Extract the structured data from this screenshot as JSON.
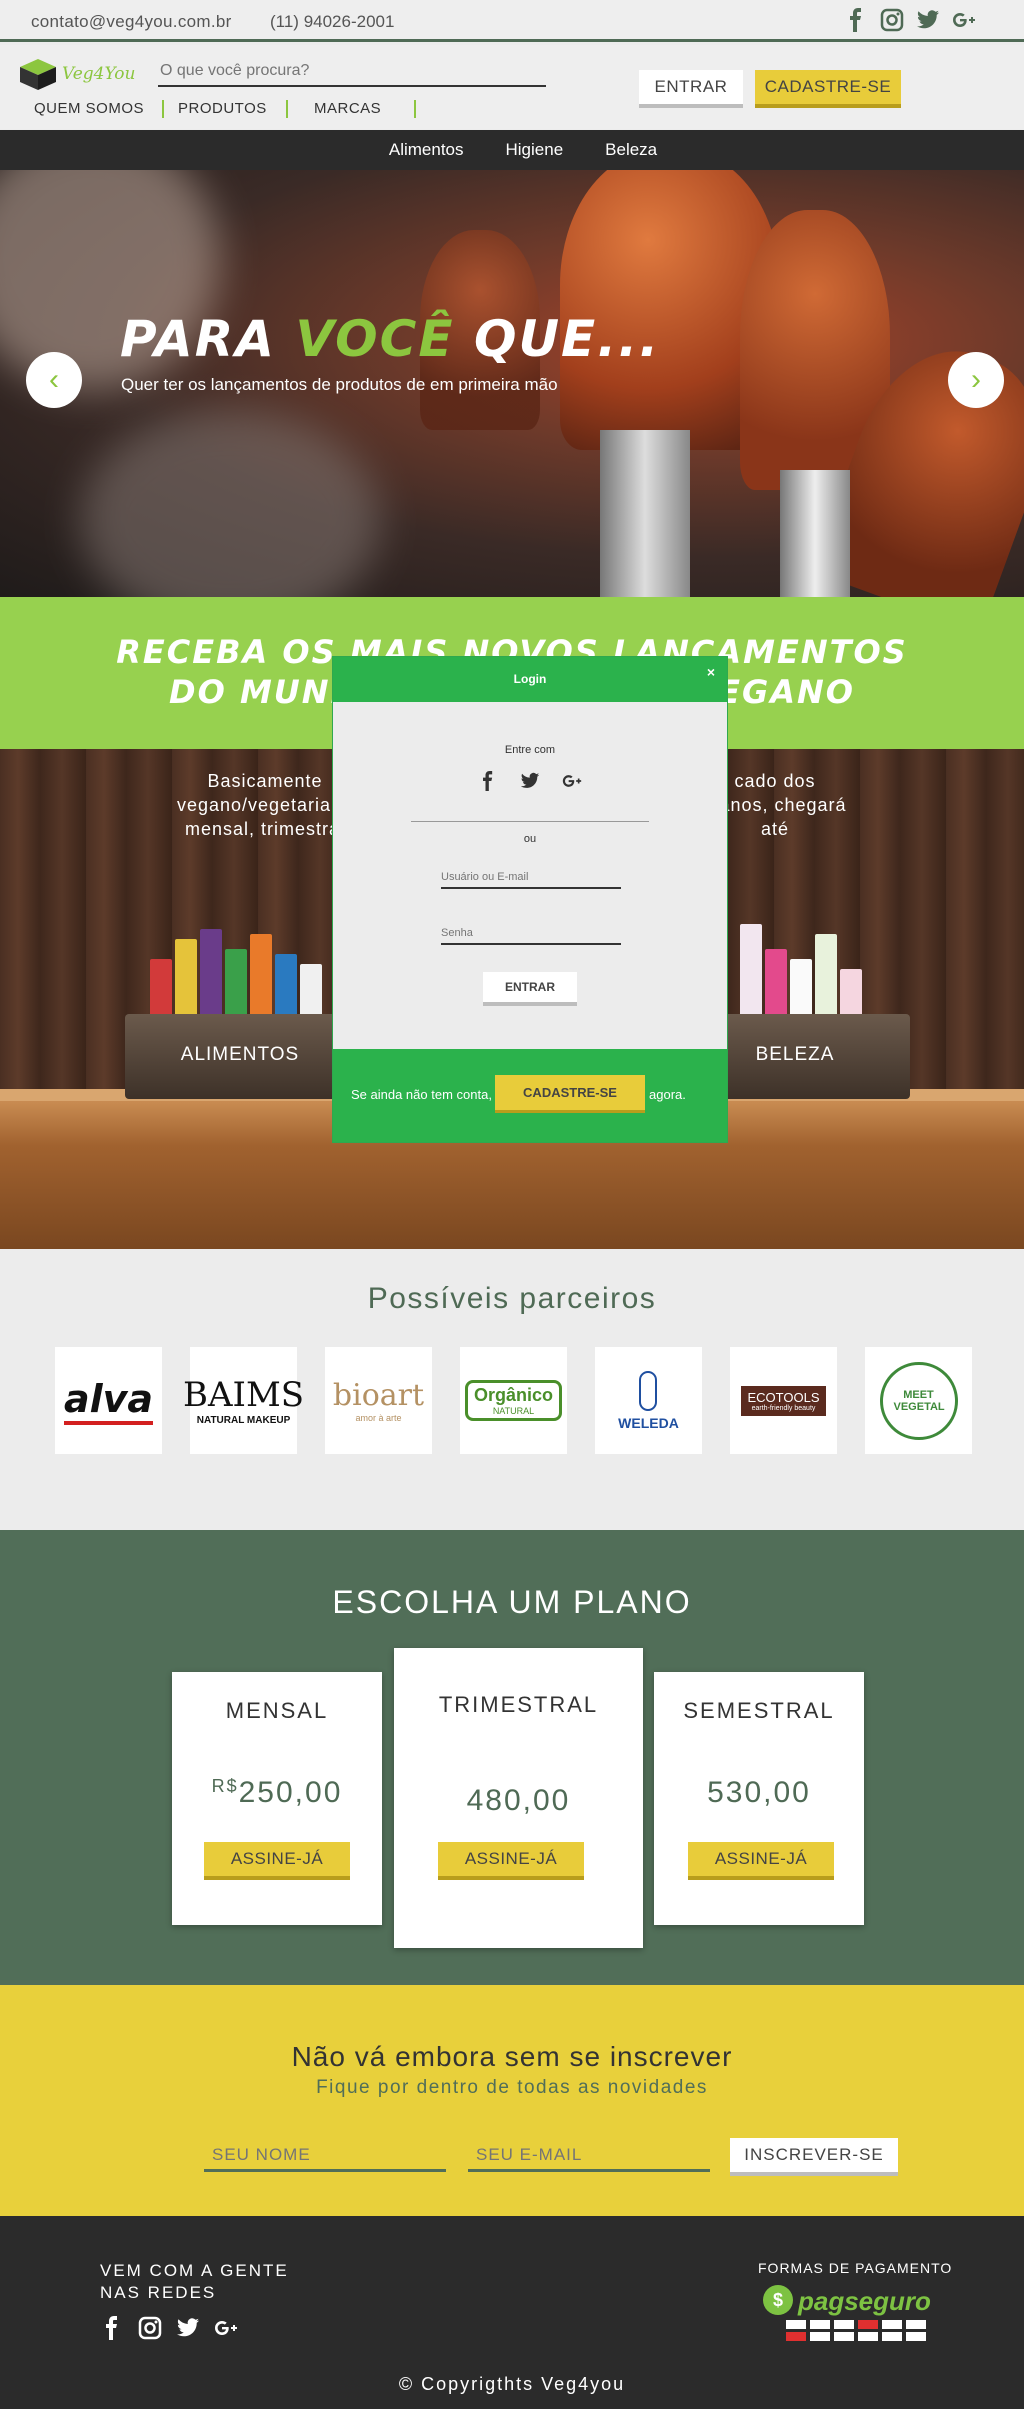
{
  "topbar": {
    "email": "contato@veg4you.com.br",
    "phone": "(11) 94026-2001",
    "social": [
      "facebook-icon",
      "instagram-icon",
      "twitter-icon",
      "google-plus-icon"
    ]
  },
  "header": {
    "brand": "Veg4You",
    "search_placeholder": "O que você procura?",
    "nav": [
      "QUEM SOMOS",
      "PRODUTOS",
      "MARCAS"
    ],
    "login_label": "ENTRAR",
    "signup_label": "CADASTRE-SE"
  },
  "categories": [
    "Alimentos",
    "Higiene",
    "Beleza"
  ],
  "hero": {
    "title_a": "PARA ",
    "title_b": "VOCÊ",
    "title_c": " QUE...",
    "subtitle": "Quer ter os lançamentos de produtos de em primeira mão",
    "prev_icon": "chevron-left-icon",
    "next_icon": "chevron-right-icon"
  },
  "banner": {
    "line1": "RECEBA OS MAIS NOVOS LANÇAMENTOS",
    "line2": "DO MUNDO VEGETARIANO/VEGANO"
  },
  "boxes": {
    "text_left": "Basicamente vegano/vegetariano mensal, trimestral",
    "text_right": "cado dos planos, chegará até",
    "left_label": "ALIMENTOS",
    "right_label": "BELEZA"
  },
  "modal": {
    "title": "Login",
    "close": "×",
    "social_prompt": "Entre com",
    "or": "ou",
    "user_placeholder": "Usuário ou E-mail",
    "password_placeholder": "Senha",
    "submit": "ENTRAR",
    "footer_before": "Se ainda não tem conta,",
    "footer_button": "CADASTRE-SE",
    "footer_after": "agora."
  },
  "partners": {
    "title": "Possíveis parceiros",
    "logos": [
      "alva",
      "BAIMS",
      "NATURAL MAKEUP",
      "bioart",
      "amor à arte",
      "Orgânico",
      "NATURAL",
      "WELEDA",
      "ECOTOOLS",
      "earth-friendly beauty",
      "MEET VEGETAL"
    ]
  },
  "plans": {
    "title": "ESCOLHA UM PLANO",
    "currency": "R$",
    "items": [
      {
        "name": "MENSAL",
        "price": "250,00",
        "button": "ASSINE-JÁ"
      },
      {
        "name": "TRIMESTRAL",
        "price": "480,00",
        "button": "ASSINE-JÁ"
      },
      {
        "name": "SEMESTRAL",
        "price": "530,00",
        "button": "ASSINE-JÁ"
      }
    ]
  },
  "newsletter": {
    "title": "Não vá embora sem se inscrever",
    "subtitle": "Fique por dentro de todas as novidades",
    "name_placeholder": "SEU NOME",
    "email_placeholder": "SEU E-MAIL",
    "button": "INSCREVER-SE"
  },
  "footer": {
    "social_title": "VEM COM A GENTE NAS REDES",
    "payment_title": "FORMAS DE PAGAMENTO",
    "payment_brand": "pagseguro",
    "copyright": "© Copyrigthts Veg4you"
  },
  "colors": {
    "accent_green": "#8cc63f",
    "dark_green": "#516e58",
    "yellow": "#e8cc3a",
    "modal_green": "#2bb24c"
  }
}
